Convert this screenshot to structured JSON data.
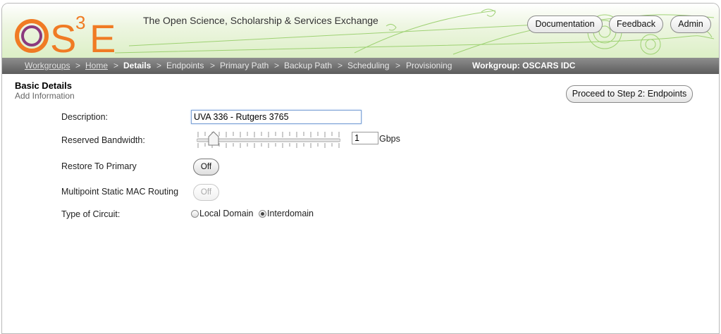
{
  "header": {
    "logo_text": "OS³E",
    "tagline": "The Open Science, Scholarship & Services Exchange",
    "buttons": {
      "documentation": "Documentation",
      "feedback": "Feedback",
      "admin": "Admin"
    }
  },
  "nav": {
    "workgroups": "Workgroups",
    "home": "Home",
    "details": "Details",
    "endpoints": "Endpoints",
    "primary_path": "Primary Path",
    "backup_path": "Backup Path",
    "scheduling": "Scheduling",
    "provisioning": "Provisioning",
    "separator": ">",
    "workgroup": "Workgroup: OSCARS IDC"
  },
  "section": {
    "title": "Basic Details",
    "subtitle": "Add Information",
    "proceed_label": "Proceed to Step 2: Endpoints"
  },
  "form": {
    "description_label": "Description:",
    "description_value": "UVA 336 - Rutgers 3765",
    "bandwidth_label": "Reserved Bandwidth:",
    "bandwidth_value": "1",
    "bandwidth_unit": "Gbps",
    "bandwidth_slider_fraction": 0.09,
    "restore_label": "Restore To Primary",
    "restore_value": "Off",
    "multipoint_label": "Multipoint Static MAC Routing",
    "multipoint_value": "Off",
    "circuit_label": "Type of Circuit:",
    "circuit_options": [
      "Local Domain",
      "Interdomain"
    ],
    "circuit_selected": "Interdomain"
  },
  "colors": {
    "logo_orange": "#f07b24",
    "logo_purple": "#8b3a7e",
    "banner_green": "#dcefc6",
    "nav_gray": "#6e6e6e"
  }
}
